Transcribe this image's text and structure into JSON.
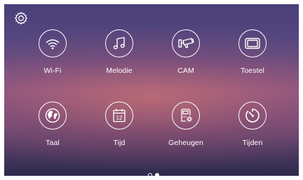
{
  "menu": {
    "items": [
      {
        "label": "Wi-Fi",
        "icon": "wifi-icon"
      },
      {
        "label": "Melodie",
        "icon": "music-note-icon"
      },
      {
        "label": "CAM",
        "icon": "security-camera-icon"
      },
      {
        "label": "Toestel",
        "icon": "monitor-device-icon"
      },
      {
        "label": "Taal",
        "icon": "globe-icon"
      },
      {
        "label": "Tijd",
        "icon": "calendar-icon"
      },
      {
        "label": "Geheugen",
        "icon": "sd-card-settings-icon"
      },
      {
        "label": "Tijden",
        "icon": "timer-icon"
      }
    ]
  },
  "settings": {
    "icon": "gear-icon"
  },
  "calendar_day": "12",
  "sd_label": "SD",
  "pagination": {
    "current": 2,
    "total": 2
  },
  "colors": {
    "accent": "#ffffff"
  }
}
